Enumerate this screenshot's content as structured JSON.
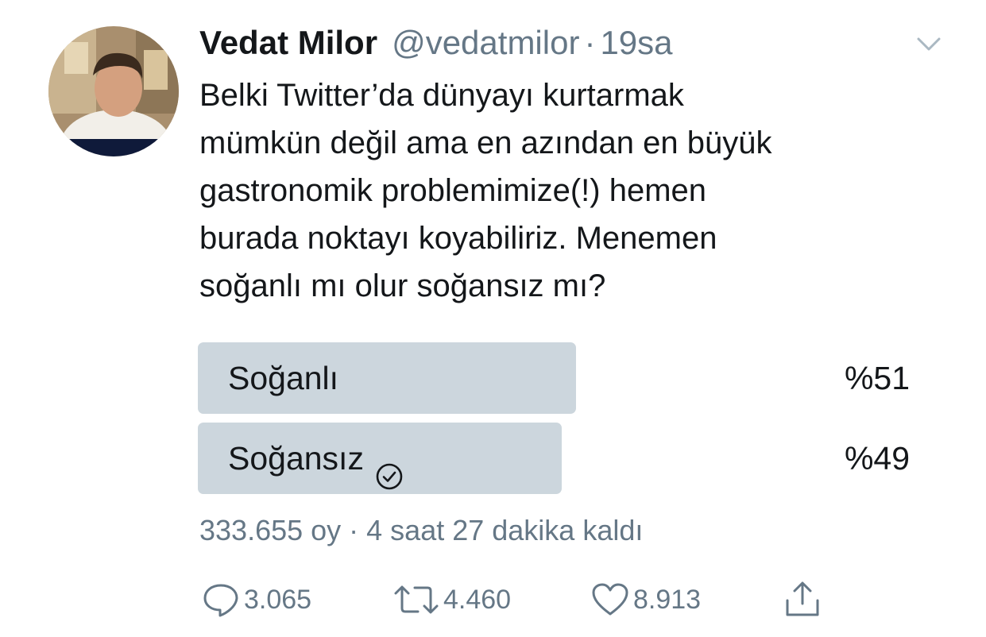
{
  "author": {
    "display_name": "Vedat Milor",
    "handle": "@vedatmilor",
    "separator": "·",
    "time": "19sa"
  },
  "tweet": {
    "text": "Belki Twitter’da dünyayı kurtarmak\nmümkün değil ama en azından en büyük\ngastronomik problemimize(!) hemen\nburada noktayı koyabiliriz. Menemen\nsoğanlı mı olur soğansız mı?"
  },
  "poll": {
    "options": [
      {
        "label": "Soğanlı",
        "percent_label": "%51",
        "percent": 51,
        "selected": false
      },
      {
        "label": "Soğansız",
        "percent_label": "%49",
        "percent": 49,
        "selected": true,
        "selected_icon": "check-circle-icon"
      }
    ],
    "meta": "333.655 oy · 4 saat 27 dakika kaldı"
  },
  "actions": {
    "reply": {
      "icon": "reply-icon",
      "count": "3.065"
    },
    "retweet": {
      "icon": "retweet-icon",
      "count": "4.460"
    },
    "like": {
      "icon": "heart-icon",
      "count": "8.913"
    },
    "share": {
      "icon": "share-icon"
    }
  },
  "colors": {
    "text": "#14171a",
    "secondary": "#657786",
    "poll_bar": "#ccd6dd"
  }
}
